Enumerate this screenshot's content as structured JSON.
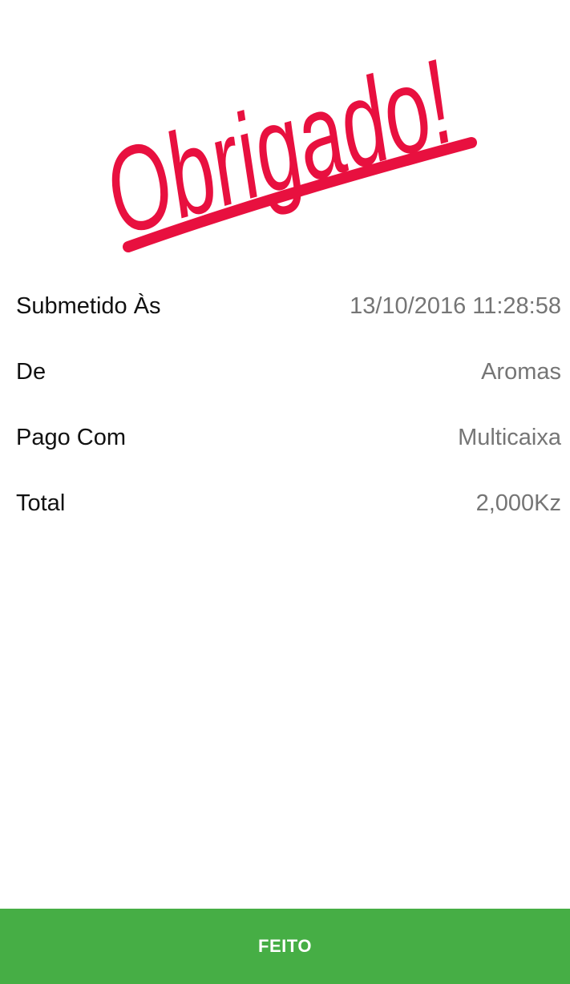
{
  "hero": {
    "logo_text": "Obrigado!",
    "color": "#e8103f"
  },
  "details": {
    "rows": [
      {
        "label": "Submetido Às",
        "value": "13/10/2016 11:28:58"
      },
      {
        "label": "De",
        "value": "Aromas"
      },
      {
        "label": "Pago Com",
        "value": "Multicaixa"
      },
      {
        "label": "Total",
        "value": "2,000Kz"
      }
    ]
  },
  "footer": {
    "done_label": "FEITO",
    "color": "#46ae45"
  }
}
